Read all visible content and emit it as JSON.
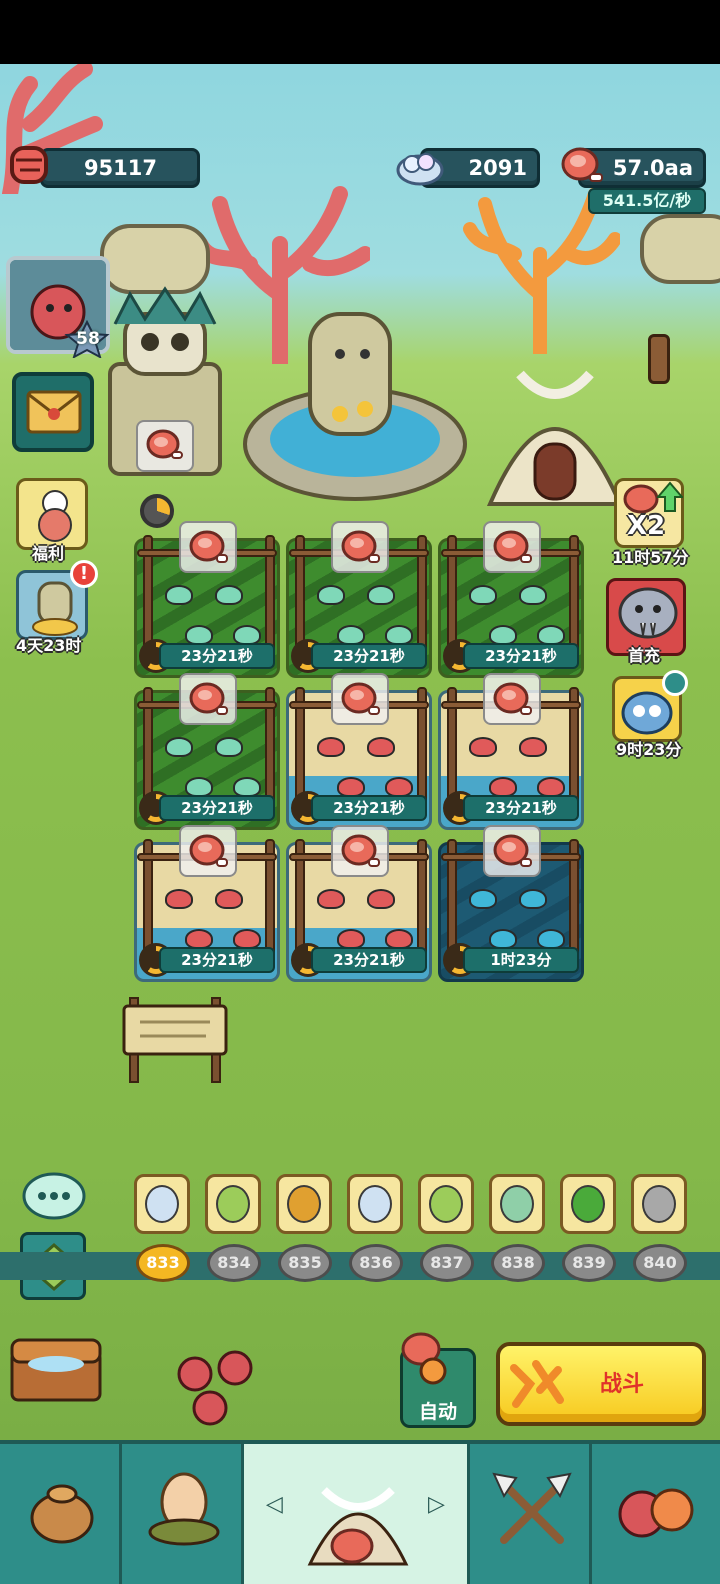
{
  "hud": {
    "power": "95117",
    "gems": "2091",
    "meat": "57.0aa",
    "meat_rate": "541.5亿/秒",
    "player_level": "58"
  },
  "side_left": {
    "welfare_label": "福利",
    "event_timer": "4天23时"
  },
  "side_right": {
    "x2_label": "X2",
    "x2_timer": "11时57分",
    "first_charge_label": "首充",
    "pet_timer": "9时23分"
  },
  "pens": [
    {
      "timer": "23分21秒",
      "type": "grass"
    },
    {
      "timer": "23分21秒",
      "type": "grass"
    },
    {
      "timer": "23分21秒",
      "type": "grass"
    },
    {
      "timer": "23分21秒",
      "type": "grass"
    },
    {
      "timer": "23分21秒",
      "type": "sand"
    },
    {
      "timer": "23分21秒",
      "type": "sand"
    },
    {
      "timer": "23分21秒",
      "type": "sand"
    },
    {
      "timer": "23分21秒",
      "type": "sand"
    },
    {
      "timer": "1时23分",
      "type": "deep"
    }
  ],
  "stages": [
    "833",
    "834",
    "835",
    "836",
    "837",
    "838",
    "839",
    "840"
  ],
  "stage_icons": [
    "gem-pile-icon",
    "green-egg-icon",
    "fire-coin-icon",
    "gem-pile-icon",
    "green-egg-icon",
    "spotted-egg-icon",
    "green-coin-icon",
    "mystery-icon"
  ],
  "current_stage": "833",
  "auto_label": "自动",
  "fight_label": "战斗",
  "colors": {
    "accent": "#f7c91e",
    "panel": "#27535d",
    "nav": "#2e8e89"
  },
  "nav": [
    "bag-icon",
    "egg-nest-icon",
    "camp-icon",
    "crossed-axes-icon",
    "tribe-members-icon"
  ]
}
